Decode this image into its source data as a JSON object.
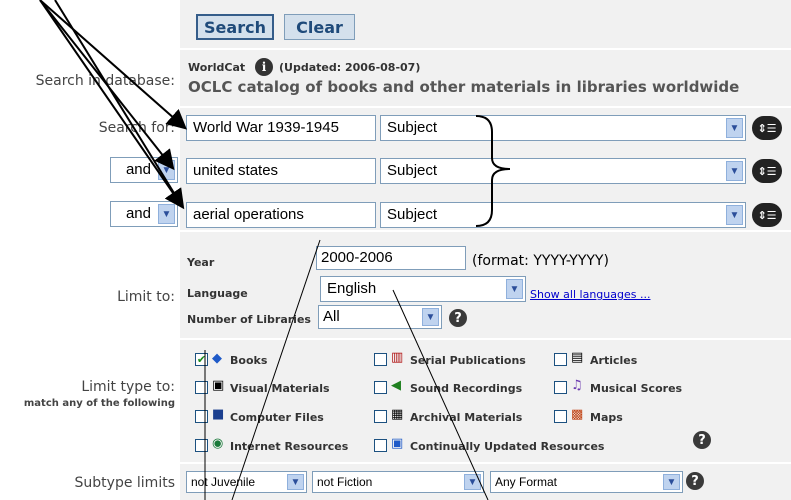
{
  "buttons": {
    "search": "Search",
    "clear": "Clear"
  },
  "database": {
    "label": "Search in database:",
    "name": "WorldCat",
    "info_icon": "info-icon",
    "updated": "(Updated: 2006-08-07)",
    "description": "OCLC catalog of books and other materials in libraries worldwide"
  },
  "search_rows": [
    {
      "prefix": "Search for:",
      "term": "World War 1939-1945",
      "index": "Subject"
    },
    {
      "prefix": "and",
      "term": "united states",
      "index": "Subject"
    },
    {
      "prefix": "and",
      "term": "aerial operations",
      "index": "Subject"
    }
  ],
  "limits": {
    "label": "Limit to:",
    "year_label": "Year",
    "year_value": "2000-2006",
    "year_format": "(format: YYYY-YYYY)",
    "language_label": "Language",
    "language_value": "English",
    "show_all": "Show all languages ...",
    "libraries_label": "Number of Libraries",
    "libraries_value": "All"
  },
  "limit_type": {
    "label": "Limit type to:",
    "sublabel": "match any of the following",
    "items": [
      {
        "label": "Books",
        "checked": true,
        "icon": "book-icon"
      },
      {
        "label": "Serial Publications",
        "checked": false,
        "icon": "serials-icon"
      },
      {
        "label": "Articles",
        "checked": false,
        "icon": "article-icon"
      },
      {
        "label": "Visual Materials",
        "checked": false,
        "icon": "camera-icon"
      },
      {
        "label": "Sound Recordings",
        "checked": false,
        "icon": "speaker-icon"
      },
      {
        "label": "Musical Scores",
        "checked": false,
        "icon": "score-icon"
      },
      {
        "label": "Computer Files",
        "checked": false,
        "icon": "disk-icon"
      },
      {
        "label": "Archival Materials",
        "checked": false,
        "icon": "archive-icon"
      },
      {
        "label": "Maps",
        "checked": false,
        "icon": "map-icon"
      },
      {
        "label": "Internet Resources",
        "checked": false,
        "icon": "globe-icon"
      },
      {
        "label": "Continually Updated Resources",
        "checked": false,
        "icon": "update-icon"
      }
    ]
  },
  "subtype": {
    "label": "Subtype limits",
    "audience": "not Juvenile",
    "content": "not Fiction",
    "format": "Any Format"
  },
  "colors": {
    "band": "#f1f1f1",
    "button": "#d4e0ec",
    "button_text": "#1f4a7a",
    "link": "#0000cc",
    "check": "#1a8a1a"
  }
}
